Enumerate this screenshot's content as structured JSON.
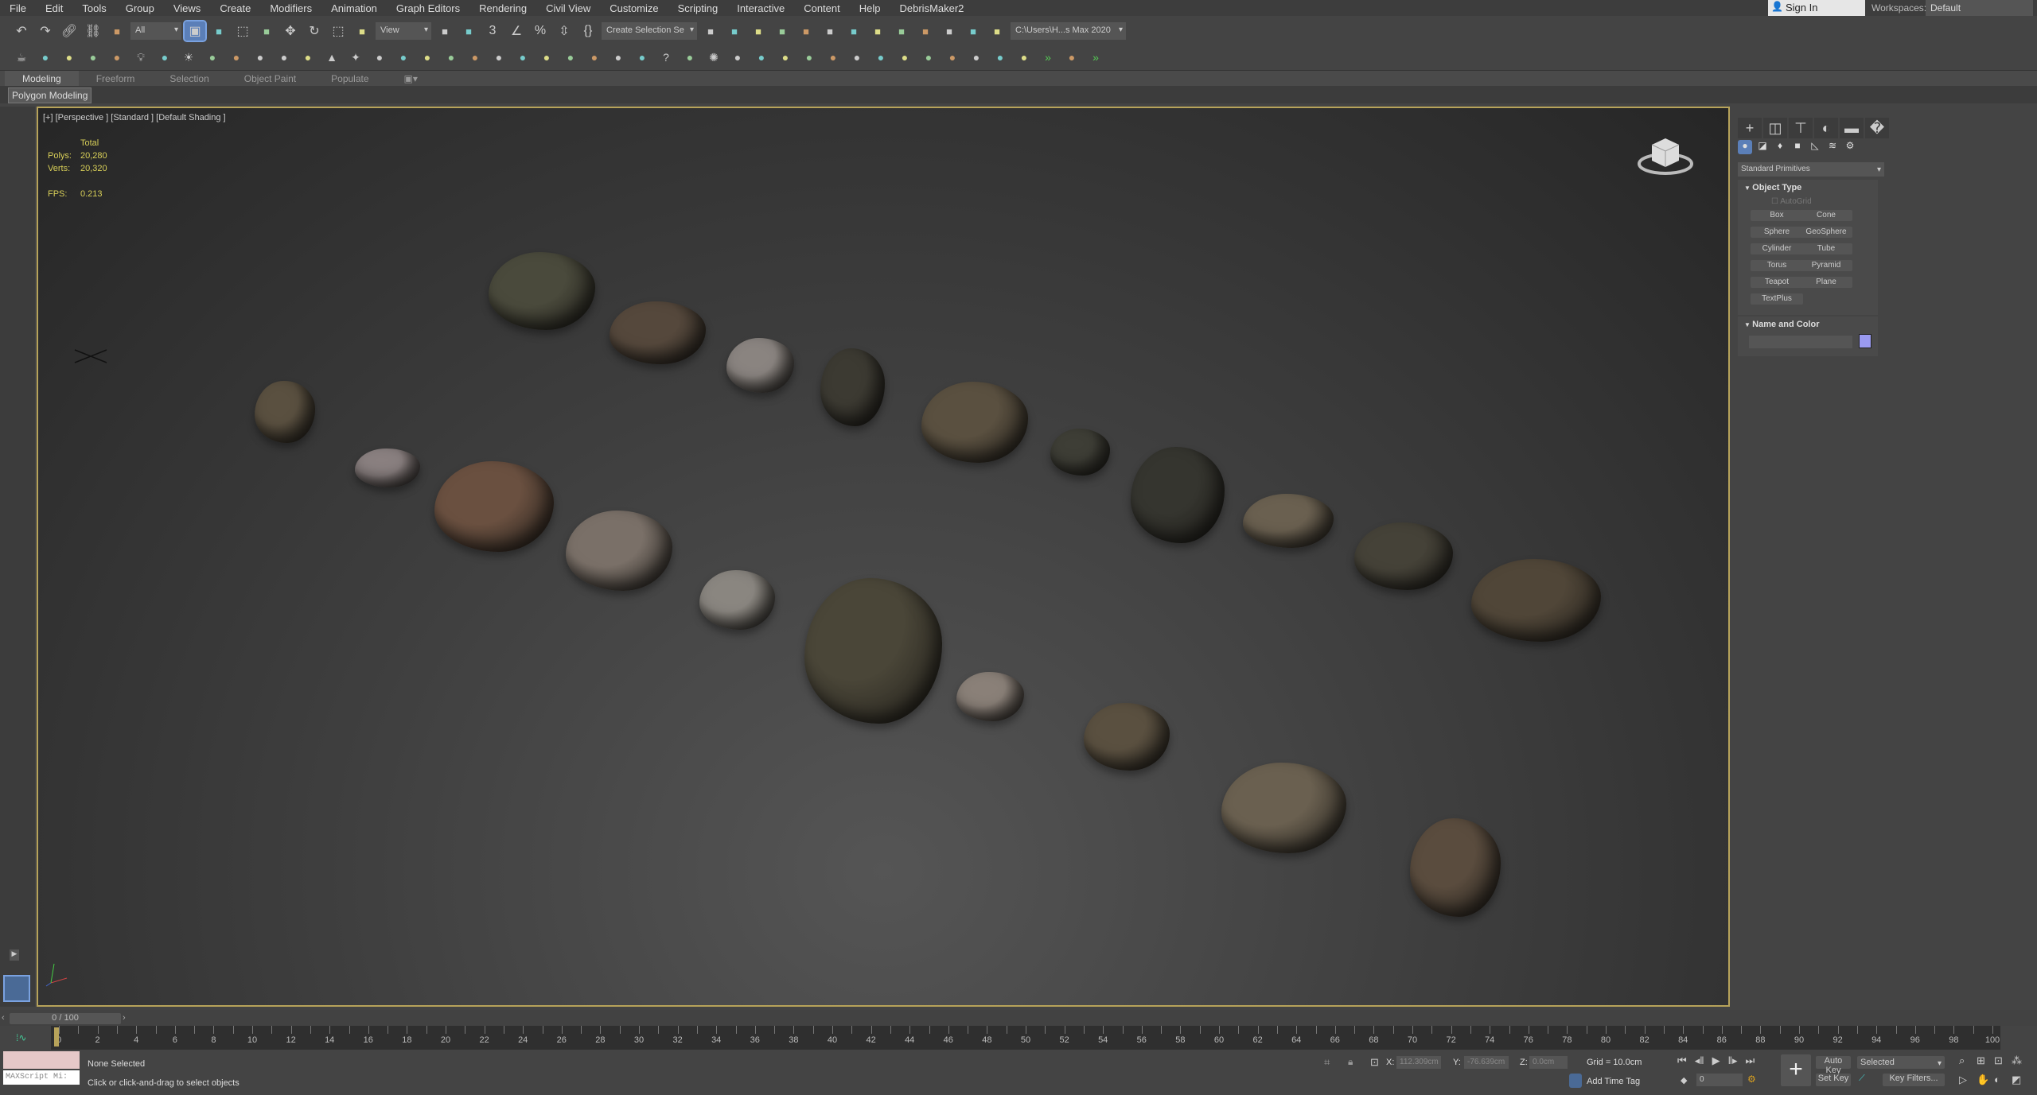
{
  "menu": [
    "File",
    "Edit",
    "Tools",
    "Group",
    "Views",
    "Create",
    "Modifiers",
    "Animation",
    "Graph Editors",
    "Rendering",
    "Civil View",
    "Customize",
    "Scripting",
    "Interactive",
    "Content",
    "Help",
    "DebrisMaker2"
  ],
  "account": {
    "sign_in": "Sign In",
    "workspaces_label": "Workspaces:",
    "workspace": "Default"
  },
  "toolbar": {
    "selection_filter": "All",
    "reference_coord": "View",
    "named_selection": "Create Selection Se",
    "project_path": "C:\\Users\\H...s Max 2020",
    "row1_icons": [
      "undo-icon",
      "redo-icon",
      "link-icon",
      "unlink-icon",
      "bind-space-warp-icon"
    ],
    "row1b_icons": [
      "select-object-icon",
      "select-by-name-icon",
      "rect-region-icon",
      "window-crossing-icon",
      "move-icon",
      "rotate-icon",
      "scale-icon",
      "placement-icon"
    ],
    "row1c_icons": [
      "pivot-icon",
      "keyboard-shortcut-icon",
      "snaps-icon",
      "angle-snap-icon",
      "percent-snap-icon",
      "spinner-snap-icon",
      "edit-named-selection-icon"
    ],
    "row1d_icons": [
      "mirror-icon",
      "align-icon",
      "scene-explorer-icon",
      "layer-explorer-icon",
      "ribbon-icon",
      "curve-editor-icon",
      "schematic-icon",
      "material-editor-icon",
      "render-setup-icon",
      "rendered-frame-icon",
      "render-icon",
      "render-cloud-icon",
      "a360-icon"
    ],
    "row2_icons": [
      "teapot-icon",
      "cloud-icon",
      "scene-icon",
      "list-icon",
      "table-icon",
      "light-icon",
      "camera-icon",
      "sun-icon",
      "plant-icon",
      "box-icon",
      "egg-icon",
      "sphere-icon",
      "geosphere-icon",
      "cone-icon",
      "star-icon",
      "ball-icon",
      "grid-icon",
      "atom-icon",
      "tower-icon",
      "snowflake-icon",
      "grass-icon",
      "hair-icon",
      "ox-icon",
      "drop-icon",
      "doc-icon",
      "blue-ball-icon",
      "phone-icon",
      "help-icon",
      "bulb-icon",
      "gear-icon",
      "camera-plus-icon",
      "tree-icon",
      "panel-icon",
      "pine-icon",
      "door-icon",
      "ring-icon",
      "monitor-icon",
      "target-icon",
      "screen-icon",
      "movie-icon",
      "cam2-icon",
      "window-icon",
      "pot-icon",
      "chevrons-icon",
      "pin-icon",
      "chevrons2-icon"
    ]
  },
  "ribbon": {
    "tabs": [
      "Modeling",
      "Freeform",
      "Selection",
      "Object Paint",
      "Populate"
    ],
    "active": "Modeling",
    "sub": "Polygon Modeling"
  },
  "viewport": {
    "label": "[+] [Perspective ] [Standard ] [Default Shading ]",
    "stats": {
      "total": "Total",
      "polys_label": "Polys:",
      "polys": "20,280",
      "verts_label": "Verts:",
      "verts": "20,320",
      "fps_label": "FPS:",
      "fps": "0.213"
    }
  },
  "command_panel": {
    "category": "Standard Primitives",
    "object_type": "Object Type",
    "autogrid": "AutoGrid",
    "buttons": [
      "Box",
      "Cone",
      "Sphere",
      "GeoSphere",
      "Cylinder",
      "Tube",
      "Torus",
      "Pyramid",
      "Teapot",
      "Plane",
      "TextPlus"
    ],
    "name_and_color": "Name and Color",
    "color": "#9a9af0"
  },
  "timeline": {
    "slider": "0 / 100",
    "start": 0,
    "end": 100,
    "step": 2
  },
  "status": {
    "maxscript": "MAXScript Mi:",
    "selection": "None Selected",
    "prompt": "Click or click-and-drag to select objects",
    "x_label": "X:",
    "x": "112.309cm",
    "y_label": "Y:",
    "y": "-76.639cm",
    "z_label": "Z:",
    "z": "0.0cm",
    "grid": "Grid = 10.0cm",
    "add_time_tag": "Add Time Tag",
    "frame": "0",
    "auto_key": "Auto Key",
    "set_key": "Set Key",
    "key_mode": "Selected",
    "key_filters": "Key Filters..."
  }
}
